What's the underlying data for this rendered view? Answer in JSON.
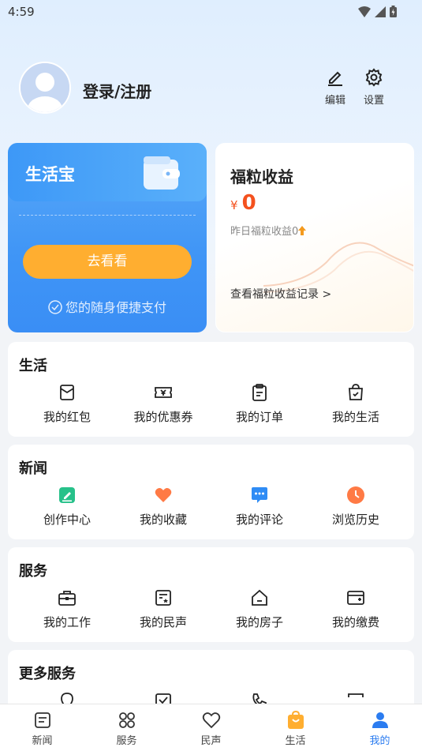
{
  "status": {
    "time": "4:59"
  },
  "profile": {
    "login_label": "登录/注册"
  },
  "top_actions": {
    "edit_label": "编辑",
    "settings_label": "设置"
  },
  "card_shb": {
    "title": "生活宝",
    "button_label": "去看看",
    "subtitle": "您的随身便捷支付"
  },
  "card_flsy": {
    "title": "福粒收益",
    "currency": "¥",
    "amount": "0",
    "yesterday": "昨日福粒收益0",
    "record_link": "查看福粒收益记录 >"
  },
  "sections": [
    {
      "title": "生活",
      "items": [
        {
          "label": "我的红包",
          "icon": "red-packet-icon"
        },
        {
          "label": "我的优惠券",
          "icon": "coupon-icon"
        },
        {
          "label": "我的订单",
          "icon": "order-icon"
        },
        {
          "label": "我的生活",
          "icon": "shopping-bag-icon"
        }
      ]
    },
    {
      "title": "新闻",
      "items": [
        {
          "label": "创作中心",
          "icon": "creation-icon",
          "color": "#27c18a"
        },
        {
          "label": "我的收藏",
          "icon": "heart-icon",
          "color": "#ff7a45"
        },
        {
          "label": "我的评论",
          "icon": "comment-icon",
          "color": "#2f8cf5"
        },
        {
          "label": "浏览历史",
          "icon": "clock-icon",
          "color": "#ff7a45"
        }
      ]
    },
    {
      "title": "服务",
      "items": [
        {
          "label": "我的工作",
          "icon": "briefcase-icon"
        },
        {
          "label": "我的民声",
          "icon": "voice-icon"
        },
        {
          "label": "我的房子",
          "icon": "house-icon"
        },
        {
          "label": "我的缴费",
          "icon": "payment-icon"
        }
      ]
    },
    {
      "title": "更多服务",
      "items": []
    }
  ],
  "tabs": [
    {
      "label": "新闻",
      "icon": "news-icon"
    },
    {
      "label": "服务",
      "icon": "service-icon"
    },
    {
      "label": "民声",
      "icon": "heart-outline-icon"
    },
    {
      "label": "生活",
      "icon": "shopping-bag-icon",
      "color": "#ffae30"
    },
    {
      "label": "我的",
      "icon": "person-icon",
      "color": "#2b7cf0",
      "active": true
    }
  ]
}
